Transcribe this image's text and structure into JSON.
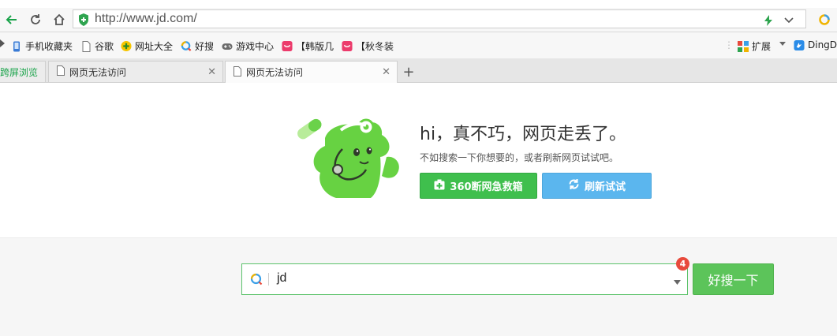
{
  "address_bar": {
    "url": "http://www.jd.com/"
  },
  "bookmarks": [
    {
      "label": "手机收藏夹",
      "icon": "phone-icon"
    },
    {
      "label": "谷歌",
      "icon": "page-icon"
    },
    {
      "label": "网址大全",
      "icon": "ie-icon"
    },
    {
      "label": "好搜",
      "icon": "haosou-icon"
    },
    {
      "label": "游戏中心",
      "icon": "gamepad-icon"
    },
    {
      "label": "【韩版几",
      "icon": "shopping-bag-icon"
    },
    {
      "label": "【秋冬装",
      "icon": "shopping-bag-icon"
    }
  ],
  "bookmarks_right": {
    "extensions_label": "扩展",
    "dingding_label": "DingD"
  },
  "tabs": {
    "first_label": "跨屏浏览",
    "items": [
      {
        "label": "网页无法访问",
        "active": false
      },
      {
        "label": "网页无法访问",
        "active": true
      }
    ]
  },
  "error": {
    "title": "hi，真不巧，网页走丢了。",
    "subtitle": "不如搜索一下你想要的，或者刷新网页试试吧。",
    "rescue_button": "360断网急救箱",
    "refresh_button": "刷新试试"
  },
  "search": {
    "query": "jd",
    "badge_count": "4",
    "button_label": "好搜一下"
  },
  "colors": {
    "green": "#3fbf4d",
    "blue": "#5bb6ee",
    "badge": "#e84a3c"
  }
}
